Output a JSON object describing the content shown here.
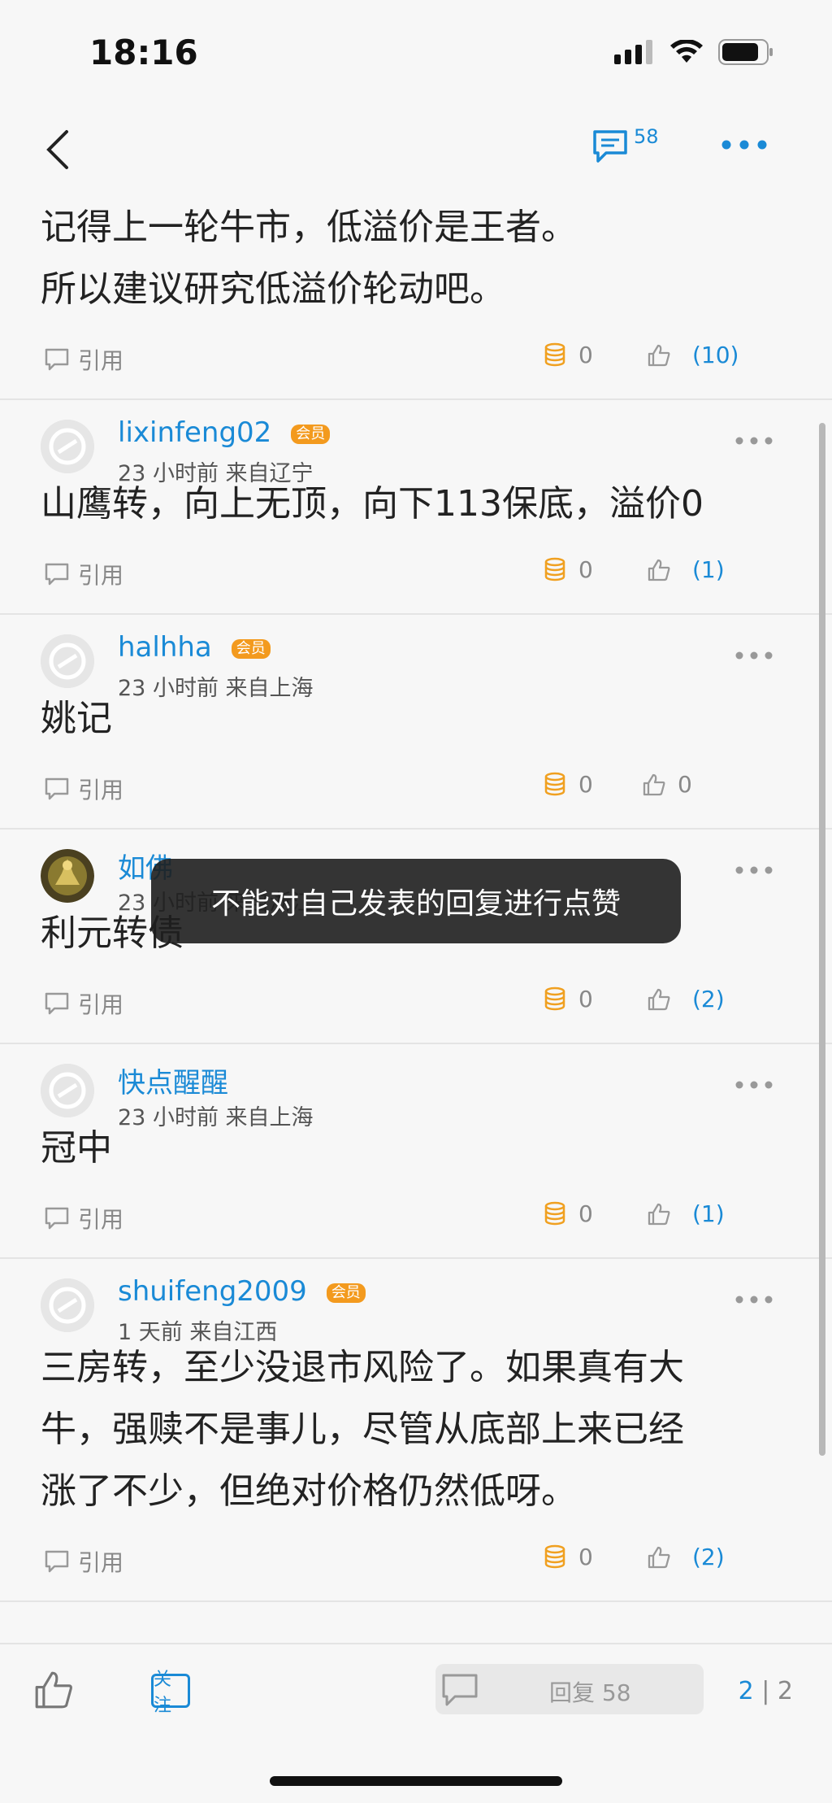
{
  "status": {
    "time": "18:16"
  },
  "nav": {
    "comment_count": "58"
  },
  "first_post": {
    "lines": [
      "记得上一轮牛市，低溢价是王者。",
      "所以建议研究低溢价轮动吧。"
    ],
    "quote_label": "引用",
    "coins": "0",
    "likes": "(10)"
  },
  "posts": [
    {
      "username": "lixinfeng02",
      "badge": "会员",
      "meta": "23 小时前 来自辽宁",
      "content": "山鹰转，向上无顶，向下113保底，溢价0",
      "quote_label": "引用",
      "coins": "0",
      "likes": "(1)"
    },
    {
      "username": "halhha",
      "badge": "会员",
      "meta": "23 小时前 来自上海",
      "content": "姚记",
      "quote_label": "引用",
      "coins": "0",
      "likes": "0"
    },
    {
      "username": "如佛",
      "meta": "23 小时前 来自浙江",
      "content": "利元转债",
      "quote_label": "引用",
      "coins": "0",
      "likes": "(2)"
    },
    {
      "username": "快点醒醒",
      "meta": "23 小时前 来自上海",
      "content": "冠中",
      "quote_label": "引用",
      "coins": "0",
      "likes": "(1)"
    },
    {
      "username": "shuifeng2009",
      "badge": "会员",
      "meta": "1 天前 来自江西",
      "content_lines": [
        "三房转，至少没退市风险了。如果真有大",
        "牛，强赎不是事儿，尽管从底部上来已经",
        "涨了不少，但绝对价格仍然低呀。"
      ],
      "quote_label": "引用",
      "coins": "0",
      "likes": "(2)"
    }
  ],
  "toast": "不能对自己发表的回复进行点赞",
  "bottom": {
    "follow_label": "关注",
    "reply_label": "回复 58",
    "page_current": "2",
    "page_sep": "|",
    "page_total": "2"
  },
  "colors": {
    "accent": "#1a8ad6",
    "badge": "#f39a1e",
    "coin": "#f0a020"
  }
}
